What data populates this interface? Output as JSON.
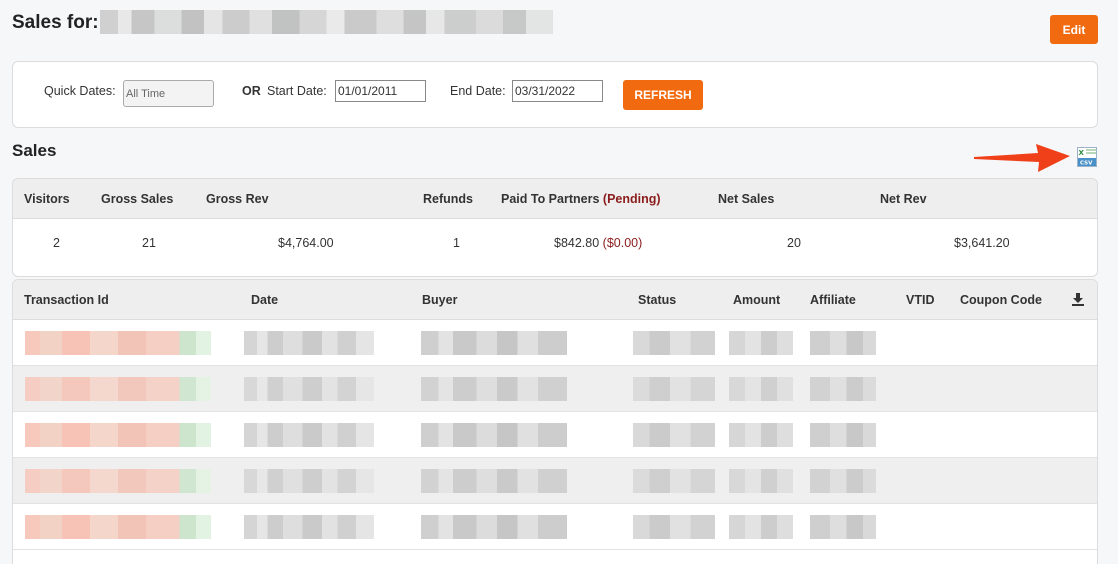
{
  "header": {
    "title": "Sales for:",
    "edit_label": "Edit"
  },
  "filters": {
    "quick_dates_label": "Quick Dates:",
    "quick_dates_value": "All Time",
    "or_label": "OR",
    "start_label": "Start Date:",
    "start_value": "01/01/2011",
    "end_label": "End Date:",
    "end_value": "03/31/2022",
    "refresh_label": "REFRESH"
  },
  "sales": {
    "title": "Sales",
    "csv_icon": "excel-csv-icon",
    "arrow_color": "#f0401a",
    "headers": {
      "visitors": "Visitors",
      "gross_sales": "Gross Sales",
      "gross_rev": "Gross Rev",
      "refunds": "Refunds",
      "paid_to_partners": "Paid To Partners",
      "pending": "(Pending)",
      "net_sales": "Net Sales",
      "net_rev": "Net Rev"
    },
    "values": {
      "visitors": "2",
      "gross_sales": "21",
      "gross_rev": "$4,764.00",
      "refunds": "1",
      "paid_to_partners": "$842.80",
      "pending": "($0.00)",
      "net_sales": "20",
      "net_rev": "$3,641.20"
    }
  },
  "transactions": {
    "columns": {
      "transaction_id": "Transaction Id",
      "date": "Date",
      "buyer": "Buyer",
      "status": "Status",
      "amount": "Amount",
      "affiliate": "Affiliate",
      "vtid": "VTID",
      "coupon_code": "Coupon Code"
    },
    "download_icon": "download-icon"
  },
  "colors": {
    "accent": "#f26a0f",
    "pending": "#8b1c1c"
  }
}
